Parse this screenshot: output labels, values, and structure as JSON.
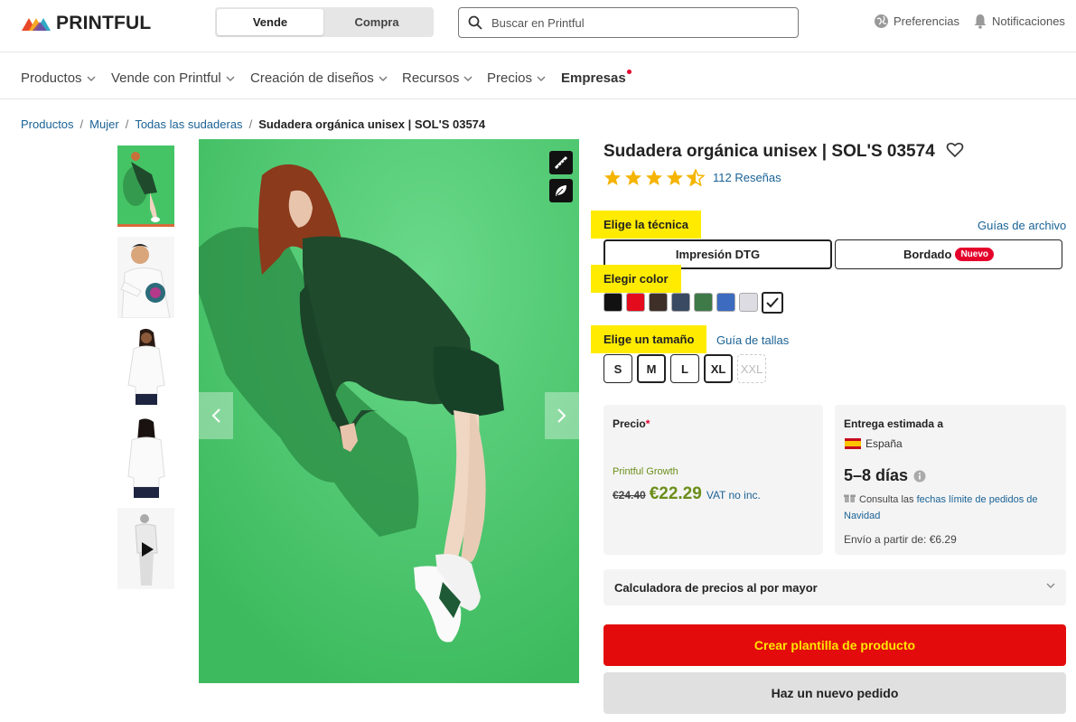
{
  "brand": {
    "logo_text": "PRINTFUL"
  },
  "mode_toggle": {
    "sell_label": "Vende",
    "buy_label": "Compra",
    "active": "Vende"
  },
  "search": {
    "placeholder": "Buscar en Printful",
    "value": ""
  },
  "header_links": {
    "preferences": "Preferencias",
    "notifications": "Notificaciones"
  },
  "nav": {
    "items": [
      {
        "label": "Productos",
        "has_dropdown": true
      },
      {
        "label": "Vende con Printful",
        "has_dropdown": true
      },
      {
        "label": "Creación de diseños",
        "has_dropdown": true
      },
      {
        "label": "Recursos",
        "has_dropdown": true
      },
      {
        "label": "Precios",
        "has_dropdown": true
      },
      {
        "label": "Empresas",
        "has_dropdown": false,
        "new_dot": true
      }
    ]
  },
  "breadcrumb": {
    "items": [
      "Productos",
      "Mujer",
      "Todas las sudaderas"
    ],
    "current": "Sudadera orgánica unisex | SOL'S 03574"
  },
  "gallery": {
    "thumbnail_icons": [
      "model-green-thumb",
      "model-print-thumb",
      "model-white-front-thumb",
      "model-white-back-thumb",
      "video-thumb"
    ],
    "active_index": 0,
    "background_color": "#45c466"
  },
  "product": {
    "title": "Sudadera orgánica unisex | SOL'S 03574",
    "rating": 4.5,
    "reviews_label": "112 Reseñas"
  },
  "technique": {
    "heading": "Elige la técnica",
    "file_guides_link": "Guías de archivo",
    "options": [
      {
        "label": "Impresión DTG",
        "selected": true
      },
      {
        "label": "Bordado",
        "badge": "Nuevo",
        "selected": false
      }
    ]
  },
  "color": {
    "heading": "Elegir color",
    "swatches": [
      "#111111",
      "#e30b1c",
      "#3e2f28",
      "#3a4a63",
      "#3e7a48",
      "#3d6bbf",
      "#dcdce2",
      "#ffffff"
    ],
    "selected_index": 7
  },
  "size": {
    "heading": "Elige un tamaño",
    "guide_link": "Guía de tallas",
    "options": [
      {
        "label": "S",
        "available": true
      },
      {
        "label": "M",
        "available": true,
        "selected": true
      },
      {
        "label": "L",
        "available": true
      },
      {
        "label": "XL",
        "available": true,
        "selected": true
      },
      {
        "label": "XXL",
        "available": false
      }
    ]
  },
  "price": {
    "label": "Precio",
    "required_mark": "*",
    "plan": "Printful Growth",
    "old": "€24.40",
    "new": "€22.29",
    "vat_note": "VAT no inc."
  },
  "delivery": {
    "label": "Entrega estimada a",
    "country": "España",
    "days": "5–8 días",
    "note_prefix": "Consulta las",
    "note_link": "fechas límite de pedidos de Navidad",
    "shipping": "Envío a partir de: €6.29"
  },
  "wholesale_calculator": {
    "label": "Calculadora de precios al por mayor"
  },
  "actions": {
    "create_template": "Crear plantilla de producto",
    "new_order": "Haz un nuevo pedido"
  },
  "colors": {
    "link": "#1a6295",
    "highlight": "#ffeb00",
    "primary_button": "#e30b0b",
    "primary_button_text": "#ffe500",
    "price_green": "#6b8e1a",
    "star": "#f5b400"
  }
}
